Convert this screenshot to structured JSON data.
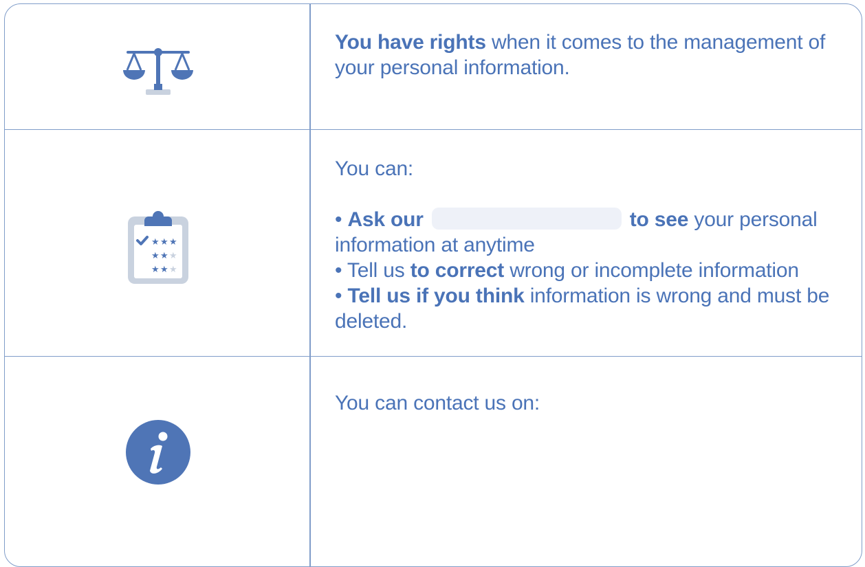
{
  "colors": {
    "accent": "#4a73b7",
    "icon_blue": "#4f75b6",
    "icon_grey": "#c9d2df",
    "border": "#7f9cc9",
    "redaction": "#eef1f8"
  },
  "rows": [
    {
      "icon": "scales-of-justice-icon",
      "segments": {
        "bold": "You have rights",
        "rest": " when it comes to the management of your personal information."
      }
    },
    {
      "icon": "clipboard-checklist-icon",
      "intro": "You can:",
      "bullet1": {
        "bullet": "•",
        "bold_a": "Ask our",
        "bold_b": "to see",
        "rest": " your personal information at anytime"
      },
      "bullet2": {
        "bullet": "•",
        "prefix": " Tell us ",
        "bold": "to correct",
        "rest": " wrong or incomplete information"
      },
      "bullet3": {
        "bullet": "•",
        "bold": "Tell us if you think",
        "rest": " information is wrong and must be deleted."
      }
    },
    {
      "icon": "info-icon",
      "text": "You can contact us on:"
    }
  ]
}
